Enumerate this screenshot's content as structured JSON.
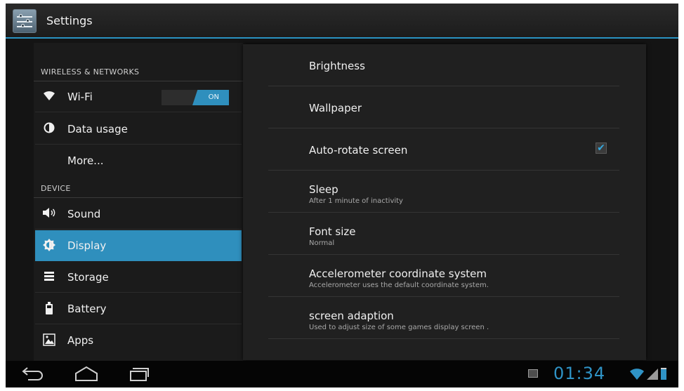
{
  "app": {
    "title": "Settings"
  },
  "left_panel": {
    "sections": [
      {
        "header": "WIRELESS & NETWORKS"
      },
      {
        "header": "DEVICE"
      }
    ],
    "items": [
      {
        "label": "Wi-Fi",
        "icon": "wifi-icon",
        "toggle": "ON"
      },
      {
        "label": "Data usage",
        "icon": "data-usage-icon"
      },
      {
        "label": "More...",
        "icon": ""
      },
      {
        "label": "Sound",
        "icon": "speaker-icon"
      },
      {
        "label": "Display",
        "icon": "brightness-icon",
        "selected": true
      },
      {
        "label": "Storage",
        "icon": "storage-icon"
      },
      {
        "label": "Battery",
        "icon": "battery-icon"
      },
      {
        "label": "Apps",
        "icon": "apps-icon"
      }
    ]
  },
  "display_settings": [
    {
      "title": "Brightness",
      "summary": ""
    },
    {
      "title": "Wallpaper",
      "summary": ""
    },
    {
      "title": "Auto-rotate screen",
      "summary": "",
      "checked": true
    },
    {
      "title": "Sleep",
      "summary": "After 1 minute of inactivity"
    },
    {
      "title": "Font size",
      "summary": "Normal"
    },
    {
      "title": "Accelerometer coordinate system",
      "summary": "Accelerometer uses the default coordinate system."
    },
    {
      "title": "screen adaption",
      "summary": "Used to adjust size of some games display screen ."
    }
  ],
  "status_bar": {
    "time": "01:34"
  },
  "colors": {
    "accent": "#2f8fbd",
    "background": "#141414",
    "panel": "#202020"
  }
}
